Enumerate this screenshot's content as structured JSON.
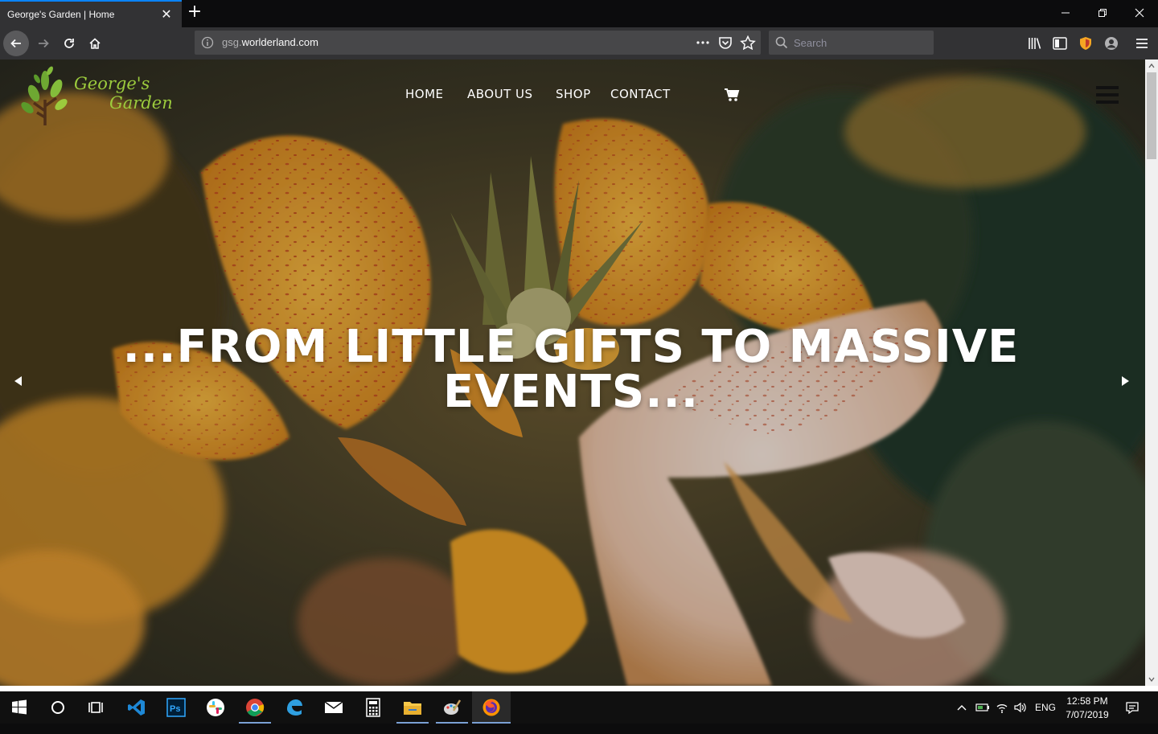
{
  "browser": {
    "tab_title": "George's Garden | Home",
    "url_host_prefix": "gsg.",
    "url_domain": "worlderland.com",
    "search_placeholder": "Search"
  },
  "site": {
    "logo_line1": "George's",
    "logo_line2": "Garden",
    "logo_color": "#9ccb3d",
    "nav": [
      "HOME",
      "ABOUT US",
      "SHOP",
      "CONTACT"
    ],
    "headline": "...FROM LITTLE GIFTS TO MASSIVE EVENTS..."
  },
  "taskbar": {
    "apps": [
      "start-icon",
      "search-icon",
      "task-view-icon",
      "vscode-icon",
      "photoshop-icon",
      "slack-icon",
      "chrome-icon",
      "edge-icon",
      "mail-icon",
      "calculator-icon",
      "file-explorer-icon",
      "paint-icon",
      "firefox-icon"
    ],
    "language": "ENG",
    "time": "12:58 PM",
    "date": "7/07/2019"
  }
}
